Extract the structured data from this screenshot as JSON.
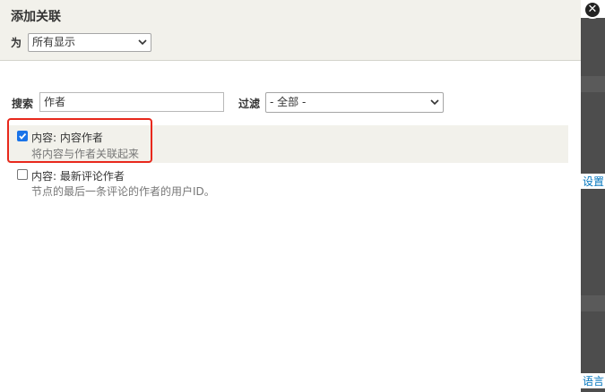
{
  "dialog": {
    "title": "添加关联",
    "for_label": "为",
    "for_value": "所有显示",
    "close_glyph": "✕"
  },
  "search": {
    "label": "搜索",
    "value": "作者"
  },
  "filter": {
    "label": "过滤",
    "value": "- 全部 -"
  },
  "items": [
    {
      "title": "内容: 内容作者",
      "description": "将内容与作者关联起来",
      "checked": true
    },
    {
      "title": "内容: 最新评论作者",
      "description": "节点的最后一条评论的作者的用户ID。",
      "checked": false
    }
  ],
  "background": {
    "link1": "设置",
    "link2": "语言"
  },
  "colors": {
    "highlight": "#e8281c",
    "checkbox_accent": "#1a73e8",
    "header_bg": "#f2f1eb"
  }
}
